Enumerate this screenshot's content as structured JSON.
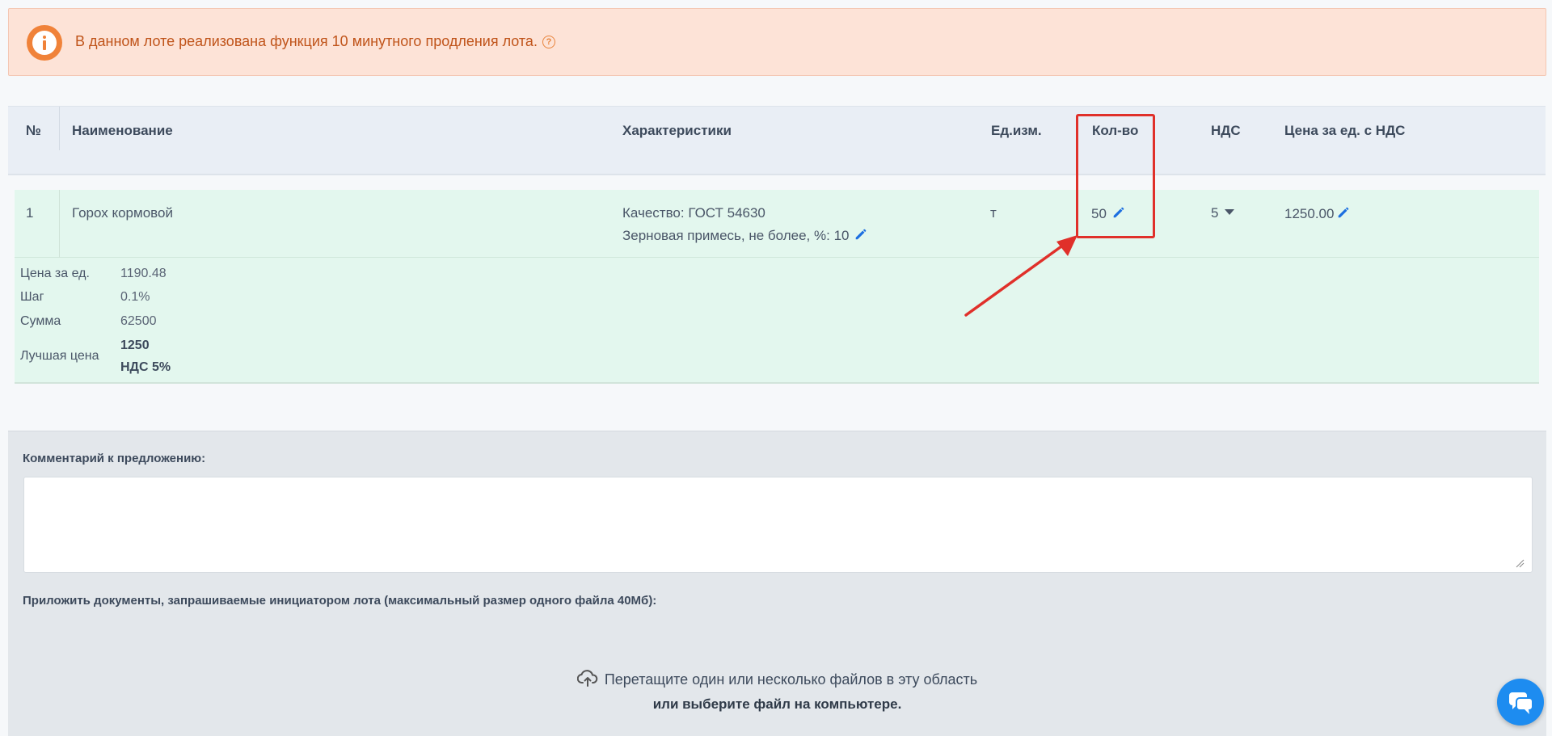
{
  "alert": {
    "text": "В данном лоте реализована функция 10 минутного продления лота.",
    "help": "?"
  },
  "table": {
    "headers": {
      "num": "№",
      "name": "Наименование",
      "specs": "Характеристики",
      "unit": "Ед.изм.",
      "qty": "Кол-во",
      "vat": "НДС",
      "price": "Цена за ед. с НДС"
    },
    "row": {
      "num": "1",
      "name": "Горох кормовой",
      "spec1": "Качество: ГОСТ 54630",
      "spec2": "Зерновая примесь, не более, %: 10",
      "unit": "т",
      "qty": "50",
      "vat": "5",
      "price": "1250.00"
    },
    "details": {
      "unit_price_label": "Цена за ед.",
      "unit_price_value": "1190.48",
      "step_label": "Шаг",
      "step_value": "0.1%",
      "sum_label": "Сумма",
      "sum_value": "62500",
      "best_label": "Лучшая цена",
      "best_value": "1250",
      "best_vat": "НДС 5%"
    }
  },
  "comment": {
    "label": "Комментарий к предложению:",
    "value": ""
  },
  "attach": {
    "label": "Приложить документы, запрашиваемые инициатором лота (максимальный размер одного файла 40Мб):",
    "drop_text": "Перетащите один или несколько файлов в эту область",
    "choose_text": "или выберите файл на компьютере."
  },
  "colors": {
    "alert_bg": "#fde3d7",
    "alert_text": "#c0541a",
    "row_bg": "#e3f7ee",
    "accent_blue": "#1d6fe0",
    "highlight_red": "#e0302a",
    "chat_blue": "#1d8cf0"
  },
  "icons": [
    "info-icon",
    "help-icon",
    "pencil-icon",
    "caret-down-icon",
    "upload-icon",
    "chat-icon"
  ]
}
